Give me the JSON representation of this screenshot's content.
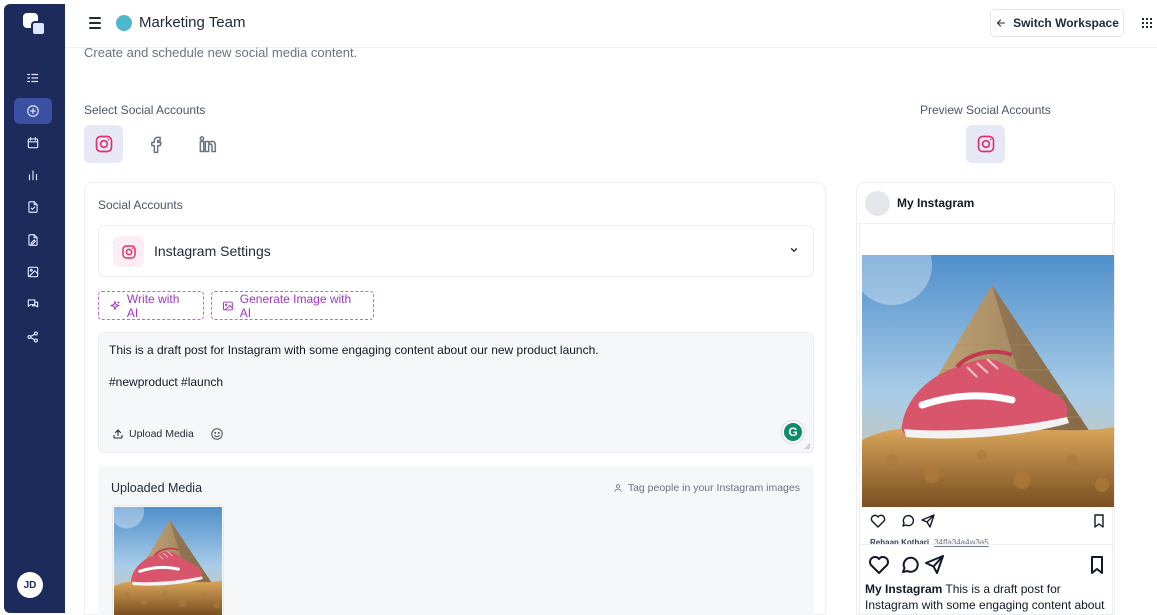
{
  "sidebar": {
    "user_initials": "JD",
    "nav_icons": [
      "list-icon",
      "plus-circle-icon",
      "calendar-icon",
      "bar-chart-icon",
      "document-icon",
      "document-edit-icon",
      "image-icon",
      "chat-icon",
      "share-icon"
    ],
    "active_index": 1,
    "accent": "#1c2a5c"
  },
  "header": {
    "team_name": "Marketing Team",
    "switch_label": "Switch Workspace"
  },
  "page": {
    "subtitle": "Create and schedule new social media content."
  },
  "accounts": {
    "select_label": "Select Social Accounts",
    "preview_label": "Preview Social Accounts",
    "options": [
      "instagram-icon",
      "facebook-icon",
      "linkedin-icon"
    ],
    "selected": "instagram-icon"
  },
  "composer": {
    "section_label": "Social Accounts",
    "settings_title": "Instagram Settings",
    "write_ai_label": "Write with AI",
    "generate_image_label": "Generate Image with AI",
    "post_text": "This is a draft post for Instagram with some engaging content about our new product launch.\n\n#newproduct #launch",
    "upload_label": "Upload Media",
    "grammarly_glyph": "G",
    "media_title": "Uploaded Media",
    "tag_label": "Tag people in your Instagram images"
  },
  "preview": {
    "account_name": "My Instagram",
    "small_user": "Rehaan Kothari",
    "small_handle": "34ffa34a4w3a5",
    "caption_user": "My Instagram",
    "caption_text": "This is a draft post for Instagram with some engaging content about"
  },
  "colors": {
    "instagram": "#e1306c",
    "ai_purple": "#a036c4",
    "grammarly": "#0f8a66"
  }
}
